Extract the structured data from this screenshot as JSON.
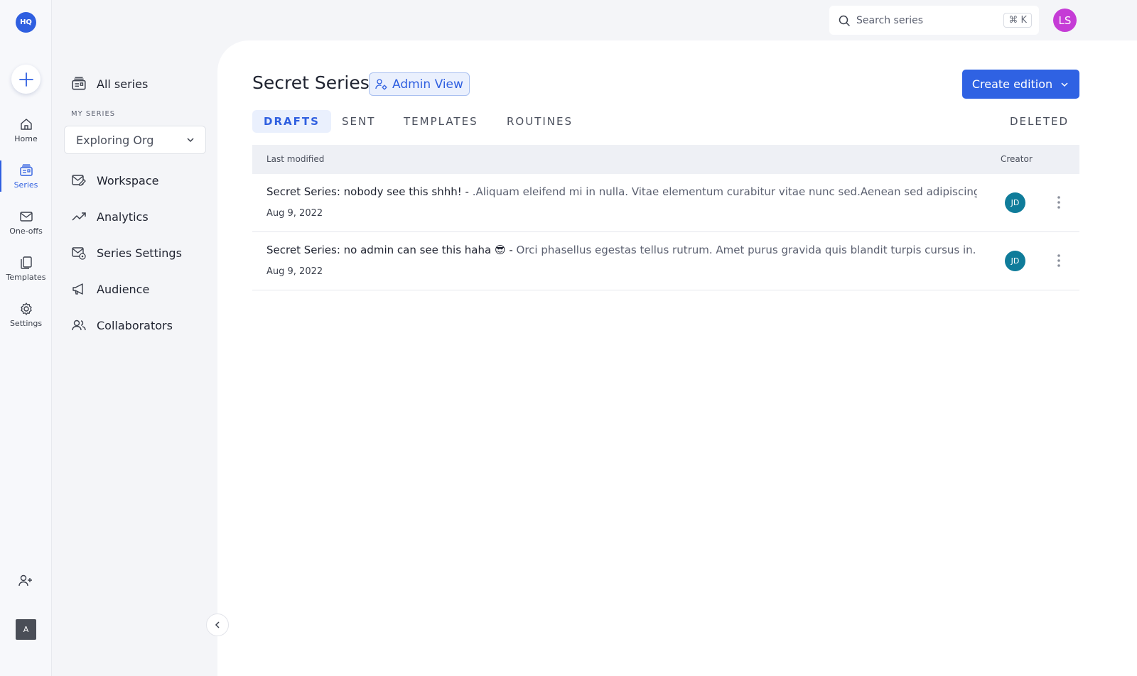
{
  "rail": {
    "logo": "HQ",
    "items": [
      {
        "label": "Home",
        "icon": "home-icon"
      },
      {
        "label": "Series",
        "icon": "series-icon"
      },
      {
        "label": "One-offs",
        "icon": "one-offs-icon"
      },
      {
        "label": "Templates",
        "icon": "templates-icon"
      },
      {
        "label": "Settings",
        "icon": "gear-icon"
      }
    ],
    "bottom_avatar": "A"
  },
  "sidebar": {
    "all_series": "All series",
    "section_label": "MY SERIES",
    "org_select": "Exploring Org",
    "items": [
      {
        "label": "Workspace",
        "icon": "workspace-icon"
      },
      {
        "label": "Analytics",
        "icon": "analytics-icon"
      },
      {
        "label": "Series Settings",
        "icon": "series-settings-icon"
      },
      {
        "label": "Audience",
        "icon": "megaphone-icon"
      },
      {
        "label": "Collaborators",
        "icon": "users-icon"
      }
    ]
  },
  "topbar": {
    "search_placeholder": "Search series",
    "shortcut": "⌘ K",
    "user_initials": "LS"
  },
  "header": {
    "title": "Secret Series",
    "badge": "Admin View",
    "create_button": "Create edition"
  },
  "tabs": [
    {
      "label": "DRAFTS",
      "active": true
    },
    {
      "label": "SENT",
      "active": false
    },
    {
      "label": "TEMPLATES",
      "active": false
    },
    {
      "label": "ROUTINES",
      "active": false
    },
    {
      "label": "DELETED",
      "active": false
    }
  ],
  "table": {
    "headers": {
      "left": "Last modified",
      "right": "Creator"
    },
    "rows": [
      {
        "title": "Secret Series: nobody see this shhh! - ",
        "preview": ".Aliquam eleifend mi in nulla. Vitae elementum curabitur vitae nunc sed.Aenean sed adipiscing...",
        "date": "Aug 9, 2022",
        "creator": "JD"
      },
      {
        "title": "Secret Series:  no admin can see this haha  😎 - ",
        "preview": "Orci phasellus egestas tellus rutrum. Amet purus gravida quis blandit turpis cursus in...",
        "date": "Aug 9, 2022",
        "creator": "JD"
      }
    ]
  },
  "colors": {
    "accent": "#2f62e3",
    "creator_avatar": "#0f7c9a",
    "user_avatar": "#c53cd6"
  }
}
